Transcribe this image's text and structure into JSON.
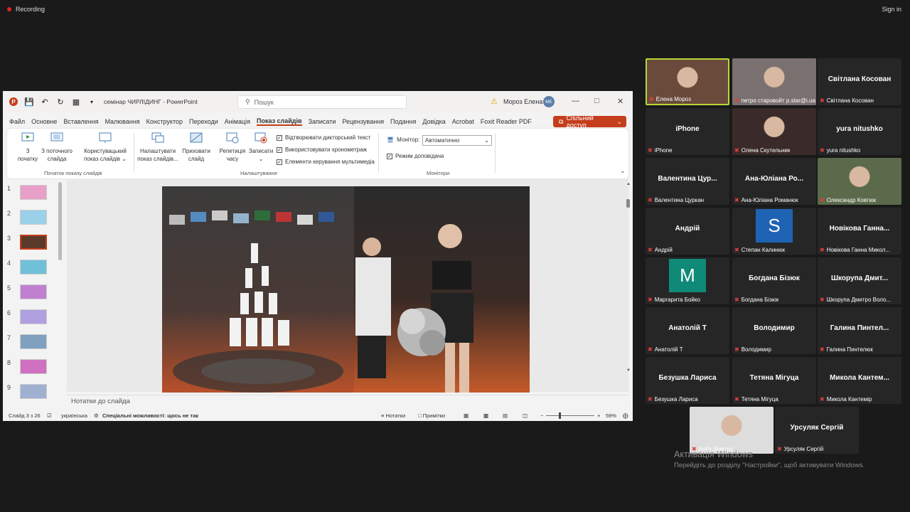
{
  "top": {
    "recording": "Recording",
    "sign_in": "Sign in"
  },
  "ppt": {
    "doc_title": "семінар ЧИРЛІДИНГ  -  PowerPoint",
    "search_placeholder": "Пошук",
    "user_name": "Мороз Елена",
    "user_initials": "МЕ",
    "menu": [
      "Файл",
      "Основне",
      "Вставлення",
      "Малювання",
      "Конструктор",
      "Переходи",
      "Анімація",
      "Показ слайдів",
      "Записати",
      "Рецензування",
      "Подання",
      "Довідка",
      "Acrobat",
      "Foxit Reader PDF"
    ],
    "active_menu_index": 7,
    "share_label": "Спільний доступ",
    "ribbon": {
      "from_start": [
        "З",
        "початку"
      ],
      "from_current": [
        "З поточного",
        "слайда"
      ],
      "custom_show": [
        "Користувацький",
        "показ слайдів ⌄"
      ],
      "setup_show": [
        "Налаштувати",
        "показ слайдів..."
      ],
      "hide_slide": [
        "Приховати",
        "слайд"
      ],
      "rehearse": [
        "Репетиція",
        "часу"
      ],
      "record": [
        "Записати",
        "⌄"
      ],
      "chk_narration": "Відтворювати дикторський текст",
      "chk_timings": "Використовувати хронометраж",
      "chk_media": "Елементи керування мультимедіа",
      "monitor_label": "Монітор:",
      "monitor_value": "Автоматично",
      "presenter_view": "Режим доповідача",
      "group_start": "Початок показу слайдів",
      "group_setup": "Налаштування",
      "group_monitors": "Монітори"
    },
    "thumbnails": [
      "1",
      "2",
      "3",
      "4",
      "5",
      "6",
      "7",
      "8",
      "9"
    ],
    "selected_slide": 3,
    "notes_placeholder": "Нотатки до слайда",
    "status": {
      "slide_counter": "Слайд 3 з 26",
      "language": "українська",
      "accessibility": "Спеціальні можливості: щось не так",
      "notes_btn": "Нотатки",
      "comments_btn": "Примітки",
      "zoom": "59%"
    },
    "colors": {
      "accent": "#c43e1c"
    }
  },
  "participants": [
    {
      "name": "",
      "label": "Елена Мороз",
      "type": "video",
      "active": true
    },
    {
      "name": "",
      "label": "петро старовойт p.star@i.ua",
      "type": "video"
    },
    {
      "name": "Світлана Косован",
      "label": "Світлана Косован",
      "type": "name"
    },
    {
      "name": "iPhone",
      "label": "iPhone",
      "type": "name"
    },
    {
      "name": "",
      "label": "Олена Скутельник",
      "type": "video"
    },
    {
      "name": "yura nitushko",
      "label": "yura nitushko",
      "type": "name"
    },
    {
      "name": "Валентина  Цур...",
      "label": "Валентина Цуркан",
      "type": "name"
    },
    {
      "name": "Ана-Юліана Ро...",
      "label": "Ана-Юліана Романюк",
      "type": "name"
    },
    {
      "name": "",
      "label": "Олександр Ковтюк",
      "type": "video"
    },
    {
      "name": "Андрій",
      "label": "Андрій",
      "type": "name"
    },
    {
      "name": "S",
      "label": "Степан Калинюк",
      "type": "letter",
      "color": "#1f63b5"
    },
    {
      "name": "Новікова  Ганна...",
      "label": "Новікова Ганна  Микол...",
      "type": "name"
    },
    {
      "name": "M",
      "label": "Маргарита Бойко",
      "type": "letter",
      "color": "#0f8a78"
    },
    {
      "name": "Богдана Бізюк",
      "label": "Богдана Бізюк",
      "type": "name"
    },
    {
      "name": "Шкорупа  Дмит...",
      "label": "Шкорупа Дмитро Воло...",
      "type": "name"
    },
    {
      "name": "Анатолій Т",
      "label": "Анатолій Т",
      "type": "name"
    },
    {
      "name": "Володимир",
      "label": "Володимир",
      "type": "name"
    },
    {
      "name": "Галина  Пинтел...",
      "label": "Галина Пинтелюк",
      "type": "name"
    },
    {
      "name": "Безушка Лариса",
      "label": "Безушка Лариса",
      "type": "name"
    },
    {
      "name": "Тетяна Мігуца",
      "label": "Тетяна Мігуца",
      "type": "name"
    },
    {
      "name": "Микола  Кантем...",
      "label": "Микола Кантемір",
      "type": "name"
    },
    {
      "name": "",
      "label": "Албу Дмитро",
      "type": "video"
    },
    {
      "name": "Урсуляк Сергій",
      "label": "Урсуляк Сергій",
      "type": "name"
    }
  ],
  "windows_activation": {
    "title": "Активація Windows",
    "message": "Перейдіть до розділу \"Настройки\", щоб активувати Windows."
  }
}
